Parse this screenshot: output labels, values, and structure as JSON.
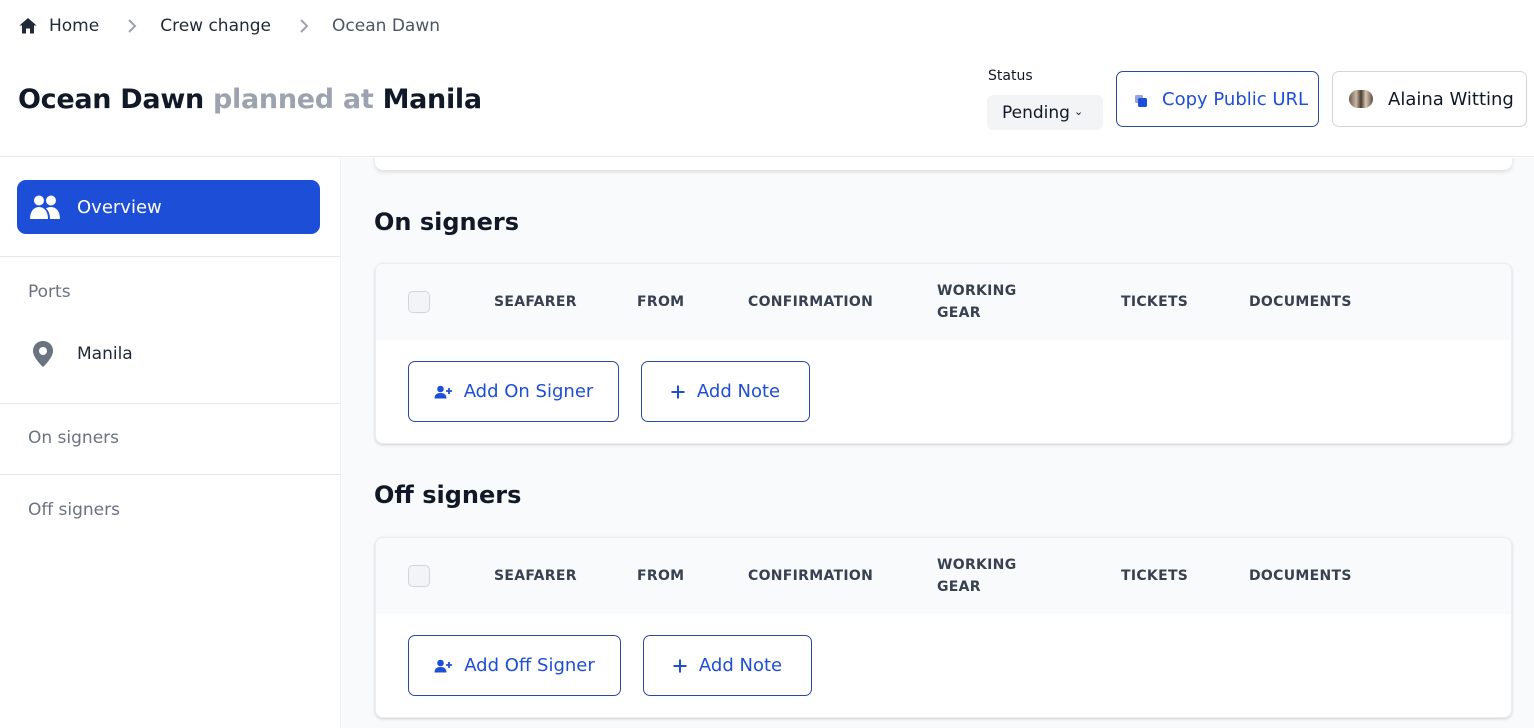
{
  "breadcrumb": {
    "items": [
      {
        "label": "Home",
        "icon": "home-icon"
      },
      {
        "label": "Crew change"
      },
      {
        "label": "Ocean Dawn"
      }
    ],
    "separator_icon": "chevron-right-icon"
  },
  "header": {
    "vessel": "Ocean Dawn",
    "connector": "planned at",
    "port": "Manila",
    "status_label": "Status",
    "status_value": "Pending",
    "copy_button": "Copy Public URL",
    "user_name": "Alaina Witting"
  },
  "sidebar": {
    "overview_label": "Overview",
    "ports_heading": "Ports",
    "ports": [
      {
        "label": "Manila",
        "icon": "map-pin-icon"
      }
    ],
    "on_signers_link": "On signers",
    "off_signers_link": "Off signers"
  },
  "sections": {
    "on_signers": {
      "title": "On signers",
      "columns": [
        "SEAFARER",
        "FROM",
        "CONFIRMATION",
        "WORKING GEAR",
        "TICKETS",
        "DOCUMENTS"
      ],
      "column_lines": {
        "working_gear": [
          "WORKING",
          "GEAR"
        ]
      },
      "add_button": "Add On Signer",
      "note_button": "Add Note"
    },
    "off_signers": {
      "title": "Off signers",
      "columns": [
        "SEAFARER",
        "FROM",
        "CONFIRMATION",
        "WORKING GEAR",
        "TICKETS",
        "DOCUMENTS"
      ],
      "column_lines": {
        "working_gear": [
          "WORKING",
          "GEAR"
        ]
      },
      "add_button": "Add Off Signer",
      "note_button": "Add Note"
    }
  },
  "colors": {
    "primary": "#1d4ed8",
    "button_border": "#2b4a9a",
    "muted_text": "#9ca3af",
    "page_bg": "#f9fafb"
  }
}
